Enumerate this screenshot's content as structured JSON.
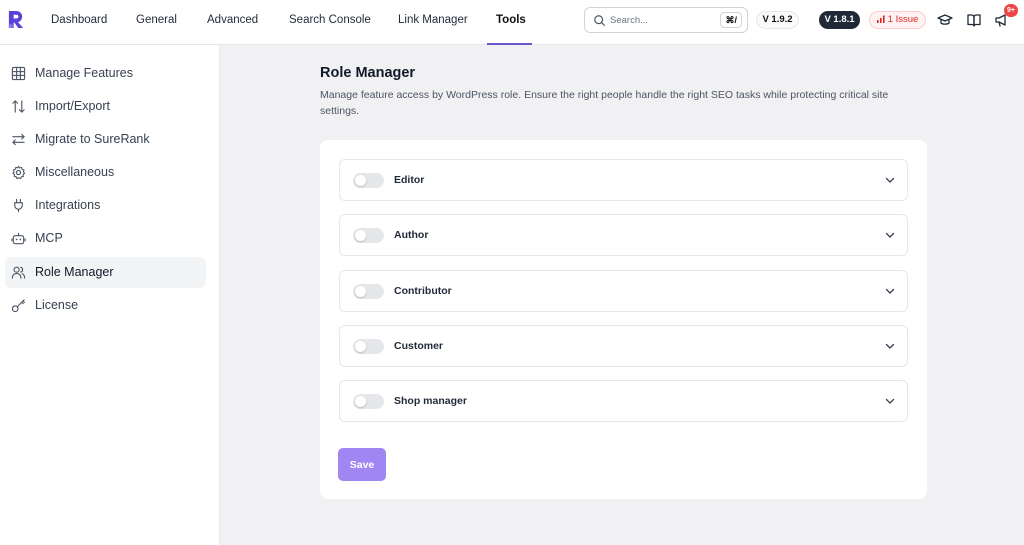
{
  "nav": {
    "tabs": [
      {
        "label": "Dashboard"
      },
      {
        "label": "General"
      },
      {
        "label": "Advanced"
      },
      {
        "label": "Search Console"
      },
      {
        "label": "Link Manager"
      },
      {
        "label": "Tools"
      }
    ],
    "active_tab": "Tools",
    "search": {
      "placeholder": "Search...",
      "shortcut": "⌘/"
    },
    "version_badges": [
      "V 1.9.2",
      "V 1.8.1"
    ],
    "issue_badge": "1 Issue",
    "notification_count": "9+"
  },
  "sidebar": {
    "items": [
      {
        "label": "Manage Features",
        "icon": "grid-icon"
      },
      {
        "label": "Import/Export",
        "icon": "arrows-updown-icon"
      },
      {
        "label": "Migrate to SureRank",
        "icon": "arrows-leftright-icon"
      },
      {
        "label": "Miscellaneous",
        "icon": "gear-icon"
      },
      {
        "label": "Integrations",
        "icon": "plug-icon"
      },
      {
        "label": "MCP",
        "icon": "bot-icon"
      },
      {
        "label": "Role Manager",
        "icon": "users-icon"
      },
      {
        "label": "License",
        "icon": "key-icon"
      }
    ],
    "active_item": "Role Manager"
  },
  "main": {
    "title": "Role Manager",
    "description": "Manage feature access by WordPress role. Ensure the right people handle the right SEO tasks while protecting critical site settings.",
    "roles": [
      {
        "label": "Editor",
        "enabled": false
      },
      {
        "label": "Author",
        "enabled": false
      },
      {
        "label": "Contributor",
        "enabled": false
      },
      {
        "label": "Customer",
        "enabled": false
      },
      {
        "label": "Shop manager",
        "enabled": false
      }
    ],
    "save_label": "Save"
  },
  "colors": {
    "accent": "#6e56cf",
    "save_button": "#9f86f2",
    "issue": "#dc2626"
  }
}
